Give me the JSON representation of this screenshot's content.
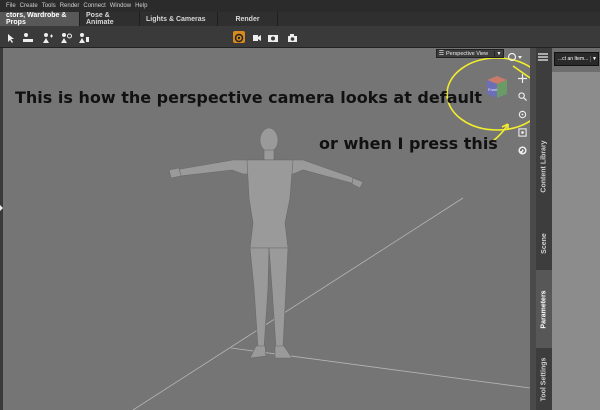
{
  "menu": [
    "File",
    "Create",
    "Tools",
    "Render",
    "Connect",
    "Window",
    "Help"
  ],
  "tabs": [
    {
      "label": "ctors, Wardrobe & Props",
      "active": true
    },
    {
      "label": "Pose & Animate",
      "active": false
    },
    {
      "label": "Lights & Cameras",
      "active": false
    },
    {
      "label": "Render",
      "active": false
    }
  ],
  "toolbar": {
    "left_icons": [
      "node-select-icon",
      "universal-tool-icon",
      "translate-tool-icon",
      "rotate-tool-icon",
      "scale-tool-icon"
    ],
    "center_icons": [
      "render-settings-icon",
      "spot-render-icon",
      "render-icon",
      "camera-icon"
    ]
  },
  "viewport": {
    "camera_label": "Perspective View",
    "cube_label": "Front",
    "annotation_1": "This is how the perspective camera looks at default",
    "annotation_2": "or when I press this"
  },
  "side_tabs": [
    "Content Library",
    "Scene",
    "Parameters",
    "Tool Settings"
  ],
  "active_side_tab": "Parameters",
  "pane": {
    "dropdown_label": "...ct an Item..."
  },
  "colors": {
    "annotation_highlight": "#f2ee2c",
    "viewport_bg": "#757575",
    "active_tab": "#585858"
  }
}
